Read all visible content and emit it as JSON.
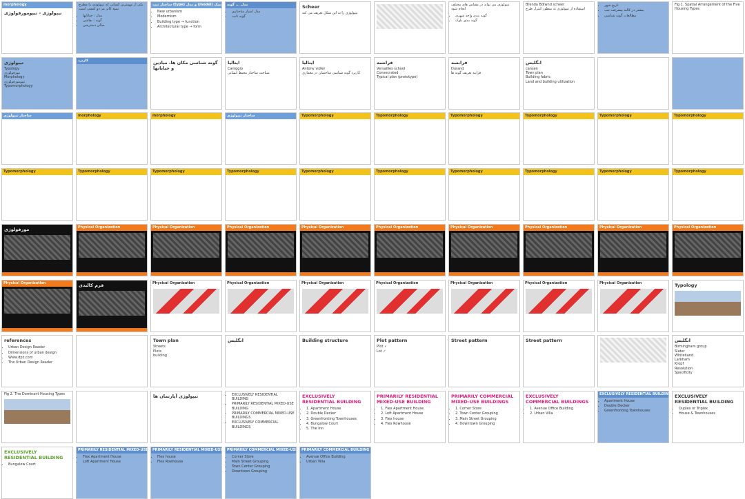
{
  "slides": [
    {
      "theme": "light",
      "header": "morphology",
      "title": "تیپولوژی - تیپومورفولوژی",
      "text": "",
      "bullets": []
    },
    {
      "theme": "blue",
      "header": "",
      "title": "",
      "text": "یکی از مهمترین کسانی که تیپولوژی را مطرح نمود کاتر مر دو کنسی است",
      "bullets": [
        "مدل : خیابانها",
        "گونه : نقاشی",
        "سالن دسترسی"
      ]
    },
    {
      "theme": "light",
      "header": "ساختار تیپ (type) و مدل (model) در ساختارهای کلاسیک",
      "title": "",
      "text": "",
      "bullets": [
        "New urbanism",
        "Modernism",
        "Building type → function",
        "Architectural type → form"
      ]
    },
    {
      "theme": "blue",
      "header": "مدل ... گونه",
      "title": "",
      "text": "",
      "bullets": [
        "مدل امتیاز ساختاری",
        "گونه ثابت"
      ]
    },
    {
      "theme": "light",
      "header": "",
      "title": "Scheer",
      "text": "تیپولوژی را به این شکل تعریف می کند",
      "bullets": []
    },
    {
      "theme": "map",
      "header": "",
      "title": "",
      "text": "",
      "bullets": []
    },
    {
      "theme": "light",
      "header": "",
      "title": "",
      "text": "تیپولوژی می تواند در مقیاس های مختلف انجام شود",
      "bullets": [
        "گونه بندی واحد شهری",
        "گونه بندی بلوک"
      ]
    },
    {
      "theme": "light",
      "header": "",
      "title": "",
      "text": "Brenda Bdiwnd scheer\nاستفاده از تیپولوژی به منظور کنترل طرح",
      "bullets": []
    },
    {
      "theme": "blue",
      "header": "",
      "title": "",
      "text": "",
      "bullets": [
        "تاریخ شهر",
        "بیشتر در کالبد پیشرفت تیپ",
        "مطالعات گونه شناسی"
      ]
    },
    {
      "theme": "light",
      "header": "",
      "title": "",
      "text": "Fig 1. Spatial Arrangement of the Five Housing Types",
      "bullets": []
    },
    {
      "theme": "blue",
      "header": "",
      "title": "تیپولوژی",
      "text": "Typology\nمورفولوژی\nMorphology\nتیپومورفولوژی\nTypomorphology",
      "bullets": []
    },
    {
      "theme": "blue",
      "header": "کاربرد",
      "title": "",
      "text": "",
      "bullets": []
    },
    {
      "theme": "light",
      "header": "",
      "title": "گونه شناسی مکان ها، میادین و خیابانها",
      "text": "",
      "bullets": []
    },
    {
      "theme": "light",
      "header": "",
      "title": "ایتالیا",
      "text": "Caniggio\nشناخت ساختار محیط انسانی",
      "bullets": []
    },
    {
      "theme": "light",
      "header": "",
      "title": "ایتالیا",
      "text": "Antony vidler\nکاربرد گونه شناسی ساختمان در معماری",
      "bullets": []
    },
    {
      "theme": "light",
      "header": "",
      "title": "فرانسه",
      "text": "Versailles school\nConsecrated\nTypical plan (prototype)",
      "bullets": []
    },
    {
      "theme": "light",
      "header": "",
      "title": "فرانسه",
      "text": "Durand\nفرایند تعریف گونه ها",
      "bullets": []
    },
    {
      "theme": "light",
      "header": "",
      "title": "انگلیس",
      "text": "cansen\nTown plan\nBuilding fabric\nLand and building utilization",
      "bullets": []
    },
    {
      "theme": "light",
      "header": "",
      "title": "",
      "text": "",
      "bullets": []
    },
    {
      "theme": "blue",
      "header": "",
      "title": "",
      "text": "",
      "bullets": []
    },
    {
      "theme": "light",
      "header": "ساختار تیپولوژی",
      "title": "",
      "text": "",
      "bullets": []
    },
    {
      "theme": "yellow",
      "header": "morphology",
      "title": "",
      "text": "",
      "bullets": []
    },
    {
      "theme": "yellow",
      "header": "morphology",
      "title": "",
      "text": "",
      "bullets": []
    },
    {
      "theme": "light",
      "header": "ساختار تیپولوژی",
      "title": "",
      "text": "",
      "bullets": []
    },
    {
      "theme": "yellow",
      "header": "Typomorphology",
      "title": "",
      "text": "",
      "bullets": []
    },
    {
      "theme": "yellow",
      "header": "Typomorphology",
      "title": "",
      "text": "",
      "bullets": []
    },
    {
      "theme": "yellow",
      "header": "Typomorphology",
      "title": "",
      "text": "",
      "bullets": []
    },
    {
      "theme": "yellow",
      "header": "Typomorphology",
      "title": "",
      "text": "",
      "bullets": []
    },
    {
      "theme": "yellow",
      "header": "Typomorphology",
      "title": "",
      "text": "",
      "bullets": []
    },
    {
      "theme": "yellow",
      "header": "Typomorphology",
      "title": "",
      "text": "",
      "bullets": []
    },
    {
      "theme": "yellow",
      "header": "Typomorphology",
      "title": "",
      "text": "",
      "bullets": []
    },
    {
      "theme": "yellow",
      "header": "Typomorphology",
      "title": "",
      "text": "",
      "bullets": []
    },
    {
      "theme": "yellow",
      "header": "Typomorphology",
      "title": "",
      "text": "",
      "bullets": []
    },
    {
      "theme": "yellow",
      "header": "Typomorphology",
      "title": "",
      "text": "",
      "bullets": []
    },
    {
      "theme": "yellow",
      "header": "Typomorphology",
      "title": "",
      "text": "",
      "bullets": []
    },
    {
      "theme": "yellow",
      "header": "Typomorphology",
      "title": "",
      "text": "",
      "bullets": []
    },
    {
      "theme": "yellow",
      "header": "Typomorphology",
      "title": "",
      "text": "",
      "bullets": []
    },
    {
      "theme": "yellow",
      "header": "Typomorphology",
      "title": "",
      "text": "",
      "bullets": []
    },
    {
      "theme": "yellow",
      "header": "Typomorphology",
      "title": "",
      "text": "",
      "bullets": []
    },
    {
      "theme": "yellow",
      "header": "Typomorphology",
      "title": "",
      "text": "",
      "bullets": []
    },
    {
      "theme": "dark",
      "header": "",
      "title": "مورفولوژی",
      "text": "",
      "bullets": []
    },
    {
      "theme": "dark",
      "header": "Physical Organization",
      "title": "",
      "text": "",
      "bullets": []
    },
    {
      "theme": "dark",
      "header": "Physical Organization",
      "title": "",
      "text": "",
      "bullets": []
    },
    {
      "theme": "dark",
      "header": "Physical Organization",
      "title": "",
      "text": "",
      "bullets": []
    },
    {
      "theme": "dark",
      "header": "Physical Organization",
      "title": "",
      "text": "",
      "bullets": []
    },
    {
      "theme": "dark",
      "header": "Physical Organization",
      "title": "",
      "text": "",
      "bullets": []
    },
    {
      "theme": "dark",
      "header": "Physical Organization",
      "title": "",
      "text": "",
      "bullets": []
    },
    {
      "theme": "dark",
      "header": "Physical Organization",
      "title": "",
      "text": "",
      "bullets": []
    },
    {
      "theme": "dark",
      "header": "Physical Organization",
      "title": "",
      "text": "",
      "bullets": []
    },
    {
      "theme": "dark",
      "header": "Physical Organization",
      "title": "",
      "text": "",
      "bullets": []
    },
    {
      "theme": "dark",
      "header": "Physical Organization",
      "title": "",
      "text": "",
      "bullets": []
    },
    {
      "theme": "dark",
      "header": "",
      "title": "فرم کالبدی",
      "text": "",
      "bullets": []
    },
    {
      "theme": "red",
      "header": "Physical Organization",
      "title": "",
      "text": "",
      "bullets": []
    },
    {
      "theme": "red",
      "header": "Physical Organization",
      "title": "",
      "text": "",
      "bullets": []
    },
    {
      "theme": "red",
      "header": "Physical Organization",
      "title": "",
      "text": "",
      "bullets": []
    },
    {
      "theme": "red",
      "header": "Physical Organization",
      "title": "",
      "text": "",
      "bullets": []
    },
    {
      "theme": "red",
      "header": "Physical Organization",
      "title": "",
      "text": "",
      "bullets": []
    },
    {
      "theme": "red",
      "header": "Physical Organization",
      "title": "",
      "text": "",
      "bullets": []
    },
    {
      "theme": "red",
      "header": "Physical Organization",
      "title": "",
      "text": "",
      "bullets": []
    },
    {
      "theme": "photo",
      "header": "",
      "title": "Typology",
      "text": "",
      "bullets": []
    },
    {
      "theme": "light",
      "header": "",
      "title": "references",
      "text": "",
      "bullets": [
        "Urban Design Reader",
        "Dimensions of urban design",
        "Www.dpz.com",
        "The Urban Design Reader"
      ]
    },
    {
      "theme": "light",
      "header": "",
      "title": "",
      "text": "",
      "bullets": []
    },
    {
      "theme": "light",
      "header": "",
      "title": "Town plan",
      "text": "Streets\nPlots\nbuilding",
      "bullets": []
    },
    {
      "theme": "light",
      "header": "",
      "title": "انگلیس",
      "text": "",
      "bullets": []
    },
    {
      "theme": "light",
      "header": "",
      "title": "Building structure",
      "text": "",
      "bullets": []
    },
    {
      "theme": "light",
      "header": "",
      "title": "Plot pattern",
      "text": "Plot ✓\nLot ✓",
      "bullets": []
    },
    {
      "theme": "light",
      "header": "",
      "title": "Street pattern",
      "text": "",
      "bullets": []
    },
    {
      "theme": "light",
      "header": "",
      "title": "Street pattern",
      "text": "",
      "bullets": []
    },
    {
      "theme": "map",
      "header": "",
      "title": "",
      "text": "",
      "bullets": []
    },
    {
      "theme": "light",
      "header": "",
      "title": "انگلیس",
      "text": "Birmingham group\nSlater\nWhitehand\nLarkham\nKropf\nResolution\nSpecificity",
      "bullets": []
    },
    {
      "theme": "photo",
      "header": "",
      "title": "",
      "text": "Fig 2. The Dominant Housing Types",
      "bullets": []
    },
    {
      "theme": "light",
      "header": "",
      "title": "",
      "text": "",
      "bullets": []
    },
    {
      "theme": "light",
      "header": "",
      "title": "تیپولوژی آپارتمان ها",
      "text": "",
      "bullets": []
    },
    {
      "theme": "light",
      "header": "",
      "title": "",
      "text": "",
      "bullets": [
        "EXCLUSIVELY RESIDENTIAL BUILDING",
        "PRIMARILY RESIDENTIAL MIXED-USE BUILDING",
        "PRIMARILY COMMERCIAL MIXED-USE BUILDINGS",
        "EXCLUSIVELY COMMERCIAL BUILDINGS"
      ]
    },
    {
      "theme": "pink",
      "header": "",
      "title": "EXCLUSIVELY RESIDENTIAL BUILDING",
      "text": "",
      "bullets": [
        "1. Apartment House",
        "2. Double Decker",
        "3. Greenfronting Townhouses",
        "4. Bungalow Court",
        "5. The Inn"
      ]
    },
    {
      "theme": "pink",
      "header": "",
      "title": "PRIMARILY RESIDENTIAL MIXED-USE BUILDING",
      "text": "",
      "bullets": [
        "1. Flex Apartment House",
        "2. Loft Apartment House",
        "3. Flex house",
        "4. Flex Rowhouse"
      ]
    },
    {
      "theme": "pink",
      "header": "",
      "title": "PRIMARILY COMMERCIAL MIXED-USE BUILDINGS",
      "text": "",
      "bullets": [
        "1. Corner Store",
        "2. Town Center Grouping",
        "3. Main Street Grouping",
        "4. Downtown Grouping"
      ]
    },
    {
      "theme": "pink",
      "header": "",
      "title": "EXCLUSIVELY COMMERCIAL BUILDINGS",
      "text": "",
      "bullets": [
        "1. Avenue Office Building",
        "2. Urban Villa"
      ]
    },
    {
      "theme": "blue",
      "header": "EXCLUSIVELY RESIDENTIAL BUILDING",
      "title": "",
      "text": "",
      "bullets": [
        "Apartment House",
        "Double Decker",
        "Greenfronting Townhouses"
      ]
    },
    {
      "theme": "light",
      "header": "",
      "title": "EXCLUSIVELY RESIDENTIAL BUILDING",
      "text": "",
      "bullets": [
        "Duplex or Triplex",
        "House & Townhouses"
      ]
    },
    {
      "theme": "green",
      "header": "",
      "title": "EXCLUSIVELY RESIDENTIAL BUILDING",
      "text": "",
      "bullets": [
        "Bungalow Court"
      ]
    },
    {
      "theme": "blue",
      "header": "PRIMARILY RESIDENTIAL MIXED-USE BUILDING",
      "title": "",
      "text": "",
      "bullets": [
        "Flex Apartment House",
        "Loft Apartment House"
      ]
    },
    {
      "theme": "blue",
      "header": "PRIMARILY RESIDENTIAL MIXED-USE BUILDING",
      "title": "",
      "text": "",
      "bullets": [
        "Flex house",
        "Flex Rowhouse"
      ]
    },
    {
      "theme": "blue",
      "header": "PRIMARILY COMMERCIAL MIXED-USE BUILDING",
      "title": "",
      "text": "",
      "bullets": [
        "Corner Store",
        "Main Street Grouping",
        "Town Center Grouping",
        "Downtown Grouping"
      ]
    },
    {
      "theme": "blue",
      "header": "PRIMARILY COMMERCIAL BUILDING",
      "title": "",
      "text": "",
      "bullets": [
        "Avenue Office Building",
        "Urban Villa"
      ]
    }
  ]
}
